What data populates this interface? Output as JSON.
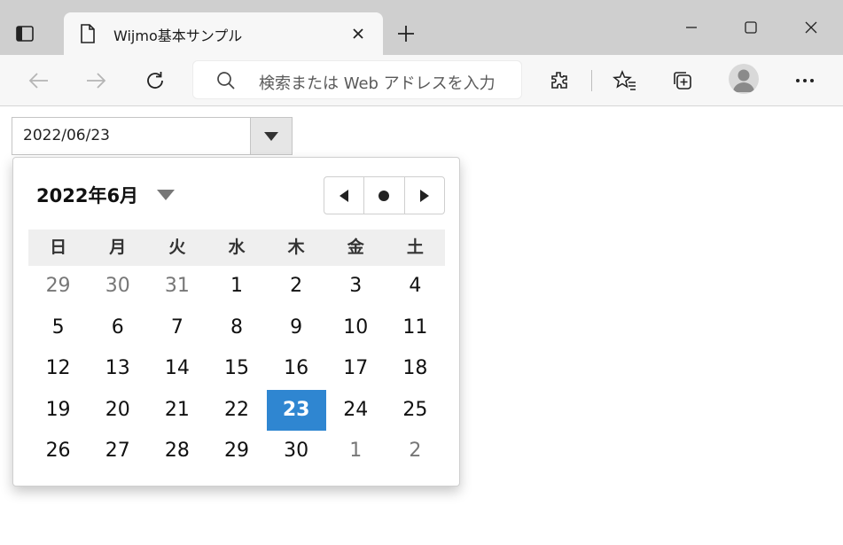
{
  "browser": {
    "tab_title": "Wijmo基本サンプル",
    "address_placeholder": "検索または Web アドレスを入力"
  },
  "datepicker": {
    "value": "2022/06/23"
  },
  "calendar": {
    "header": "2022年6月",
    "weekdays": [
      "日",
      "月",
      "火",
      "水",
      "木",
      "金",
      "土"
    ],
    "weeks": [
      [
        "29",
        "30",
        "31",
        "1",
        "2",
        "3",
        "4"
      ],
      [
        "5",
        "6",
        "7",
        "8",
        "9",
        "10",
        "11"
      ],
      [
        "12",
        "13",
        "14",
        "15",
        "16",
        "17",
        "18"
      ],
      [
        "19",
        "20",
        "21",
        "22",
        "23",
        "24",
        "25"
      ],
      [
        "26",
        "27",
        "28",
        "29",
        "30",
        "1",
        "2"
      ]
    ],
    "selected_color": "#2f86d1"
  }
}
